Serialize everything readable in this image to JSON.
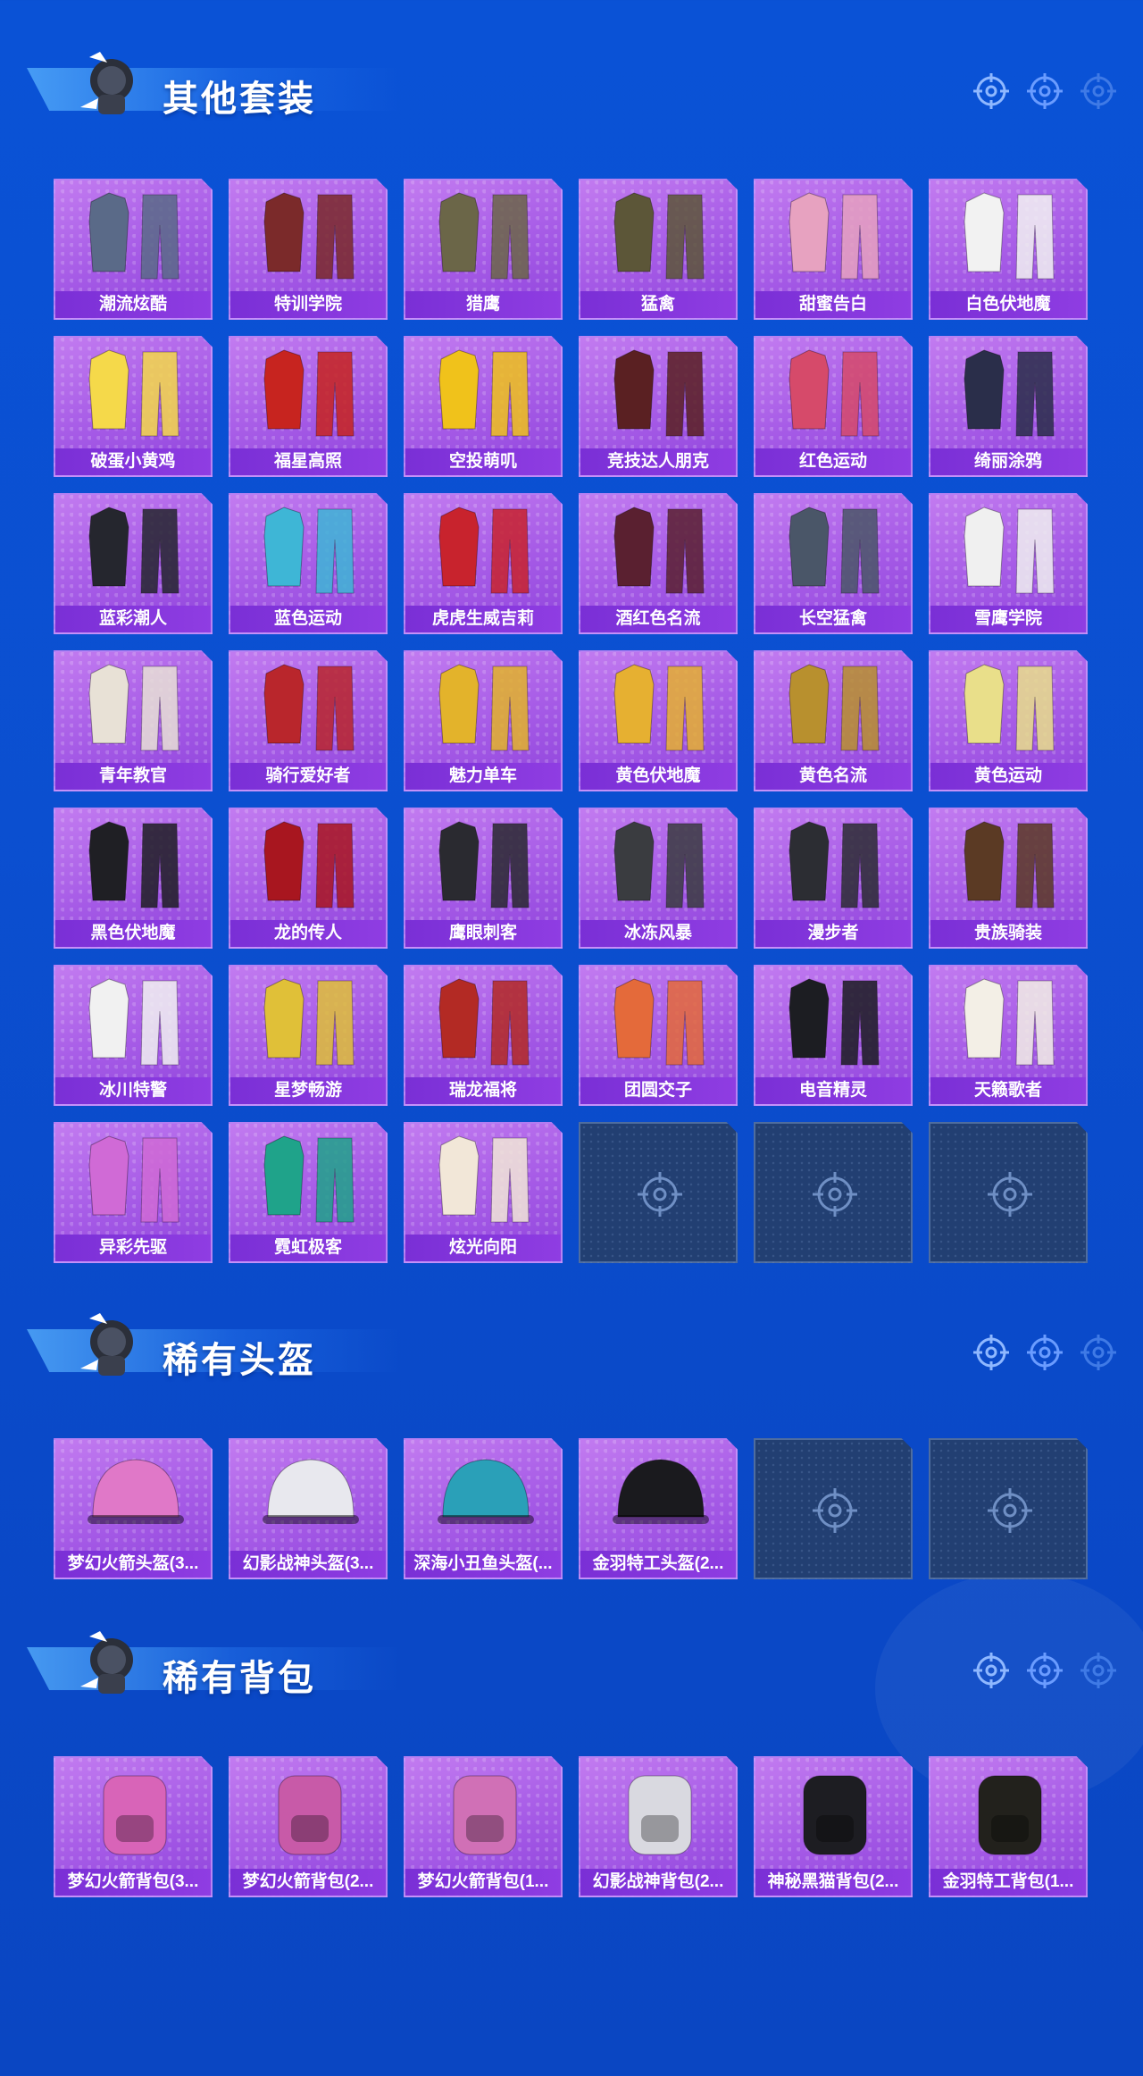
{
  "sections": [
    {
      "title": "其他套装",
      "items": [
        {
          "label": "潮流炫酷",
          "color": "#5a6a88"
        },
        {
          "label": "特训学院",
          "color": "#7b2a2a"
        },
        {
          "label": "猎鹰",
          "color": "#6b6648"
        },
        {
          "label": "猛禽",
          "color": "#5c5638"
        },
        {
          "label": "甜蜜告白",
          "color": "#e7a2c0"
        },
        {
          "label": "白色伏地魔",
          "color": "#f2f2f2"
        },
        {
          "label": "破蛋小黄鸡",
          "color": "#f5d94a"
        },
        {
          "label": "福星高照",
          "color": "#c7241f"
        },
        {
          "label": "空投萌叽",
          "color": "#f0c21b"
        },
        {
          "label": "竞技达人朋克",
          "color": "#5a2022"
        },
        {
          "label": "红色运动",
          "color": "#d64a6a"
        },
        {
          "label": "绮丽涂鸦",
          "color": "#2a2e4a"
        },
        {
          "label": "蓝彩潮人",
          "color": "#25262e"
        },
        {
          "label": "蓝色运动",
          "color": "#3eb6d6"
        },
        {
          "label": "虎虎生威吉莉",
          "color": "#c8232d"
        },
        {
          "label": "酒红色名流",
          "color": "#5a2030"
        },
        {
          "label": "长空猛禽",
          "color": "#4a5668"
        },
        {
          "label": "雪鹰学院",
          "color": "#f0f0f0"
        },
        {
          "label": "青年教官",
          "color": "#e8e1d6"
        },
        {
          "label": "骑行爱好者",
          "color": "#b9262c"
        },
        {
          "label": "魅力单车",
          "color": "#e3b32b"
        },
        {
          "label": "黄色伏地魔",
          "color": "#e6b031"
        },
        {
          "label": "黄色名流",
          "color": "#b8902e"
        },
        {
          "label": "黄色运动",
          "color": "#e9df8a"
        },
        {
          "label": "黑色伏地魔",
          "color": "#1f1f24"
        },
        {
          "label": "龙的传人",
          "color": "#a8161f"
        },
        {
          "label": "鹰眼刺客",
          "color": "#2a2a30"
        },
        {
          "label": "冰冻风暴",
          "color": "#3a3c40"
        },
        {
          "label": "漫步者",
          "color": "#2c2d33"
        },
        {
          "label": "贵族骑装",
          "color": "#5b3a24"
        },
        {
          "label": "冰川特警",
          "color": "#f1f1f1"
        },
        {
          "label": "星梦畅游",
          "color": "#e0c038"
        },
        {
          "label": "瑞龙福将",
          "color": "#b32a24"
        },
        {
          "label": "团圆交子",
          "color": "#e46a3a"
        },
        {
          "label": "电音精灵",
          "color": "#1c1d22"
        },
        {
          "label": "天籁歌者",
          "color": "#f3efe6"
        },
        {
          "label": "异彩先驱",
          "color": "#d06ad6"
        },
        {
          "label": "霓虹极客",
          "color": "#1fa38a"
        },
        {
          "label": "炫光向阳",
          "color": "#f2e7d8"
        }
      ],
      "empty_slots": 3
    },
    {
      "title": "稀有头盔",
      "items": [
        {
          "label": "梦幻火箭头盔(3...",
          "color": "#e078c8"
        },
        {
          "label": "幻影战神头盔(3...",
          "color": "#e8e8ee"
        },
        {
          "label": "深海小丑鱼头盔(...",
          "color": "#2aa0b8"
        },
        {
          "label": "金羽特工头盔(2...",
          "color": "#1a1a1e"
        }
      ],
      "empty_slots": 2
    },
    {
      "title": "稀有背包",
      "items": [
        {
          "label": "梦幻火箭背包(3...",
          "color": "#d864b8"
        },
        {
          "label": "梦幻火箭背包(2...",
          "color": "#c85aa8"
        },
        {
          "label": "梦幻火箭背包(1...",
          "color": "#d070b6"
        },
        {
          "label": "幻影战神背包(2...",
          "color": "#d9d9e0"
        },
        {
          "label": "神秘黑猫背包(2...",
          "color": "#1d1d22"
        },
        {
          "label": "金羽特工背包(1...",
          "color": "#22211c"
        }
      ],
      "empty_slots": 0
    }
  ],
  "colors": {
    "background": "#0a4fd0",
    "card_purple": "#a55ae6",
    "label_bar": "#7a2fd6",
    "empty_slot": "#223f72"
  }
}
